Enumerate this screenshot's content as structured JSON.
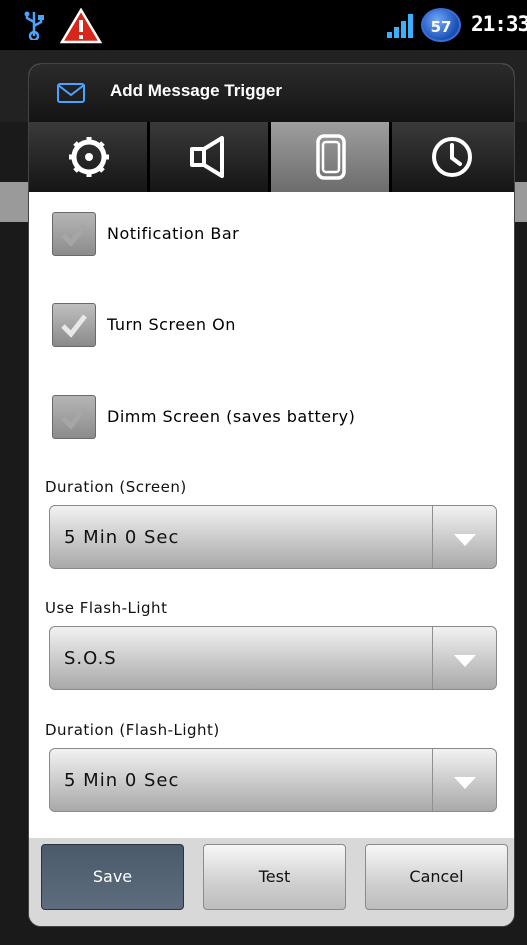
{
  "status_bar": {
    "time": "21:33",
    "battery_level": "57",
    "icons": [
      "usb-icon",
      "warning-icon",
      "signal-icon",
      "battery-icon"
    ]
  },
  "dialog": {
    "title": "Add Message Trigger",
    "header_icon": "mail-icon",
    "tabs": [
      {
        "icon": "settings-gear-icon",
        "selected": false
      },
      {
        "icon": "speaker-icon",
        "selected": false
      },
      {
        "icon": "phone-screen-icon",
        "selected": true
      },
      {
        "icon": "clock-icon",
        "selected": false
      }
    ],
    "options": [
      {
        "label": "Notification Bar",
        "checked": false
      },
      {
        "label": "Turn Screen On",
        "checked": true
      },
      {
        "label": "Dimm Screen (saves battery)",
        "checked": false
      }
    ],
    "duration_screen": {
      "label": "Duration (Screen)",
      "value": "5 Min  0 Sec"
    },
    "flash_light": {
      "label": "Use Flash-Light",
      "value": "S.O.S"
    },
    "duration_flash": {
      "label": "Duration (Flash-Light)",
      "value": "5 Min  0 Sec"
    },
    "buttons": {
      "save": "Save",
      "test": "Test",
      "cancel": "Cancel"
    }
  },
  "colors": {
    "header_bg": "#1c1c1c",
    "tab_selected": "#8a8a8a",
    "battery_blue": "#1a4fb3",
    "warning_red": "#d8261b"
  }
}
